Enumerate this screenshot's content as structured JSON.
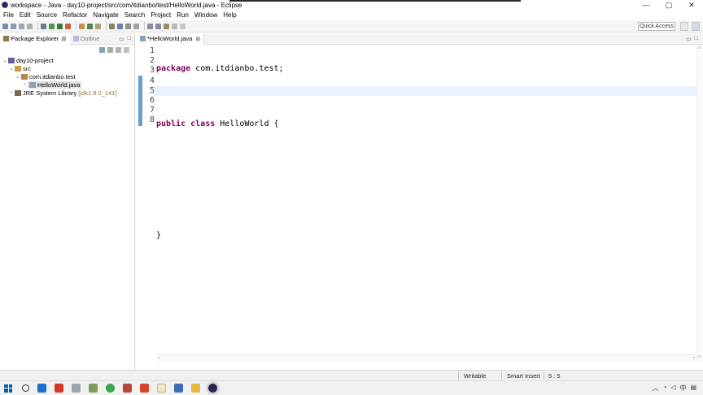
{
  "window": {
    "title": "workspace - Java - day10-project/src/com/itdianbo/test/HelloWorld.java - Eclipse",
    "minimize": "—",
    "maximize": "▢",
    "close": "✕"
  },
  "menu": [
    "File",
    "Edit",
    "Source",
    "Refactor",
    "Navigate",
    "Search",
    "Project",
    "Run",
    "Window",
    "Help"
  ],
  "toolbar": {
    "quick_access": "Quick Access"
  },
  "left_panel": {
    "tabs": [
      {
        "label": "Package Explorer",
        "suffix": "⊠"
      },
      {
        "label": "Outline"
      }
    ],
    "tree": [
      {
        "label": "day10-project",
        "toggle": "⌄",
        "icon_color": "#6b5a9e"
      },
      {
        "label": "src",
        "toggle": "⌄",
        "icon_color": "#c8a040"
      },
      {
        "label": "com.itdianbo.test",
        "toggle": "⌄",
        "icon_color": "#b08848"
      },
      {
        "label": "HelloWorld.java",
        "toggle": "›",
        "icon_color": "#8ea0b8"
      },
      {
        "label": "JRE System Library",
        "version": "[jdk1.8.0_141]",
        "toggle": "›",
        "icon_color": "#7a6a4a"
      }
    ]
  },
  "editor": {
    "tab_label": "*HelloWorld.java",
    "tab_close": "⊠",
    "line_numbers": [
      "1",
      "2",
      "3",
      "4",
      "5",
      "6",
      "7",
      "8"
    ],
    "code_lines": [
      {
        "kw": "package",
        "rest": " com.itdianbo.test;"
      },
      {
        "kw": "",
        "rest": ""
      },
      {
        "kw": "public class",
        "rest": " HelloWorld {"
      },
      {
        "kw": "",
        "rest": ""
      },
      {
        "kw": "",
        "rest": ""
      },
      {
        "kw": "",
        "rest": ""
      },
      {
        "kw": "",
        "rest": "}"
      },
      {
        "kw": "",
        "rest": ""
      }
    ]
  },
  "status": {
    "writable": "Writable",
    "insert_mode": "Smart Insert",
    "position": "5 : 5"
  },
  "colors": {
    "keyword": "#7f0055",
    "change_bar": "#6a9fcf",
    "current_line": "#e8f2fe"
  }
}
